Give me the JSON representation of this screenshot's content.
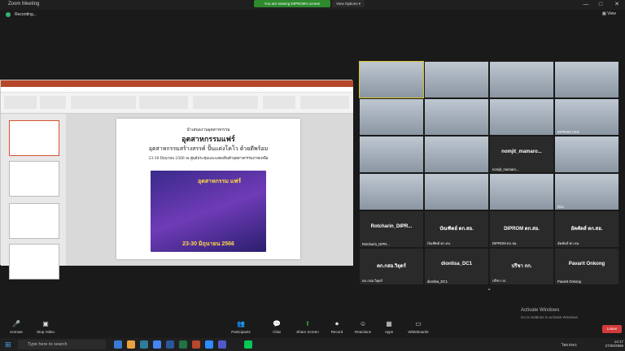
{
  "window": {
    "title": "Zoom Meeting",
    "minimize": "—",
    "maximize": "□",
    "close": "✕"
  },
  "view_banner": {
    "viewing_label": "You are viewing DIPROM's screen",
    "options_label": "View Options ▾"
  },
  "recording": {
    "label": "Recording...",
    "view_button": "▦ View"
  },
  "shared_screen": {
    "slide": {
      "line1": "นำเสนองานอุตสาหกรรม",
      "line2": "อุตสาหกรรมแฟร์",
      "line3": "อุตสาหกรรมสร้างสรรค์ ปั้นแต่งโคโว ด้วยดีพร้อม",
      "line4": "23-30 มิถุนายน 2566 ณ ศูนย์ประชุมและแสดงสินค้าอุตสาหกรรมภาคเหนือ",
      "poster_title": "อุตสาหกรรม แฟร์",
      "poster_date": "23-30 มิถุนายน 2566"
    }
  },
  "gallery": {
    "tiles": [
      {
        "name": "",
        "type": "video"
      },
      {
        "name": "",
        "type": "video"
      },
      {
        "name": "",
        "type": "video"
      },
      {
        "name": "",
        "type": "video"
      },
      {
        "name": "",
        "type": "video"
      },
      {
        "name": "",
        "type": "video"
      },
      {
        "name": "",
        "type": "video"
      },
      {
        "name": "DIPROM CEO",
        "type": "video"
      },
      {
        "name": "",
        "type": "video"
      },
      {
        "name": "",
        "type": "video"
      },
      {
        "name": "nomjit_mamaro...",
        "type": "name"
      },
      {
        "name": "",
        "type": "video"
      },
      {
        "name": "",
        "type": "video"
      },
      {
        "name": "",
        "type": "video"
      },
      {
        "name": "",
        "type": "video"
      },
      {
        "name": "DCL",
        "type": "video"
      },
      {
        "name": "Rotcharin_DIPR...",
        "type": "name"
      },
      {
        "name": "บัณฑิตย์ ตก.สอ.",
        "type": "name"
      },
      {
        "name": "DIPROM ตก.สอ.",
        "type": "name"
      },
      {
        "name": "อัคคัดส์ ตก.สอ.",
        "type": "name"
      },
      {
        "name": "ตก.กสอ.วิยุตร์",
        "type": "name"
      },
      {
        "name": "dionlisa_DC1",
        "type": "name"
      },
      {
        "name": "ปรีชา กก.",
        "type": "name"
      },
      {
        "name": "Pavarit Onkong",
        "type": "name"
      }
    ]
  },
  "toolbar": {
    "unmute": "Unmute",
    "stop_video": "Stop Video",
    "participants": "Participants",
    "participants_count": "24",
    "chat": "Chat",
    "share_screen": "Share Screen",
    "record": "Record",
    "reactions": "Reactions",
    "apps": "Apps",
    "whiteboards": "Whiteboards",
    "end": "Leave"
  },
  "activation": {
    "title": "Activate Windows",
    "subtitle": "Go to Settings to activate Windows."
  },
  "taskbar": {
    "search_placeholder": "Type here to search",
    "time": "14:17",
    "date": "27/06/2566",
    "tray": "ไทย ENG"
  }
}
